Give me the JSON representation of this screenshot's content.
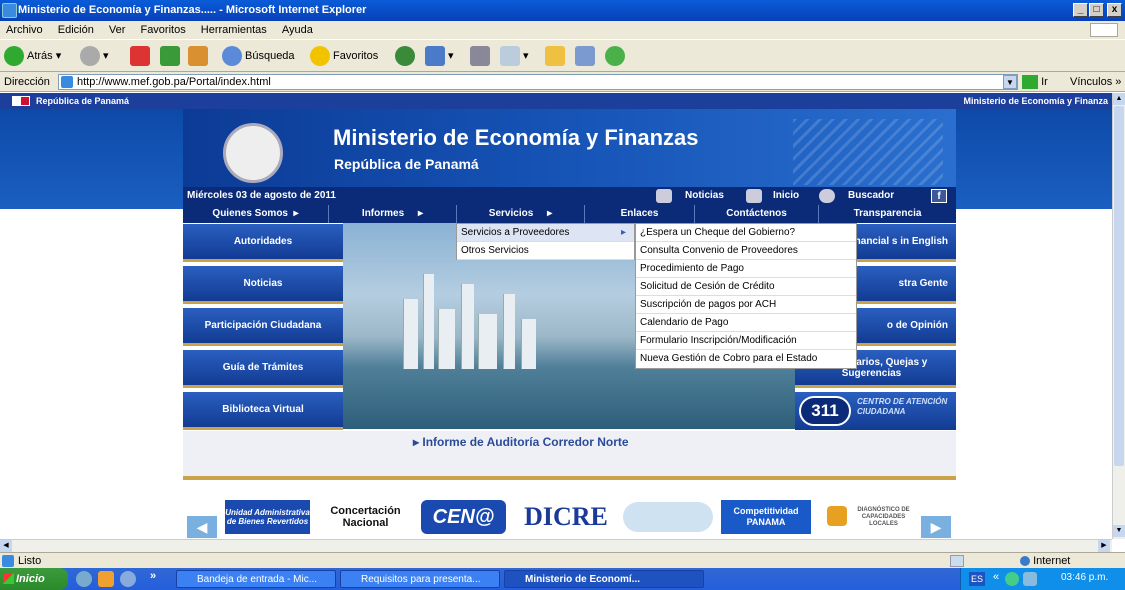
{
  "window": {
    "title": "Ministerio de Economía y Finanzas..... - Microsoft Internet Explorer",
    "min": "_",
    "max": "□",
    "close": "x"
  },
  "menubar": [
    "Archivo",
    "Edición",
    "Ver",
    "Favoritos",
    "Herramientas",
    "Ayuda"
  ],
  "toolbar": {
    "back": "Atrás",
    "search": "Búsqueda",
    "favorites": "Favoritos"
  },
  "address": {
    "label": "Dirección",
    "url": "http://www.mef.gob.pa/Portal/index.html",
    "go": "Ir",
    "links": "Vínculos"
  },
  "page": {
    "top_left": "República de Panamá",
    "top_right": "Ministerio de Economía y Finanza",
    "banner_title": "Ministerio de Economía y Finanzas",
    "banner_subtitle": "República de Panamá",
    "date": "Miércoles 03 de agosto de 2011",
    "quick_links": [
      "Noticias",
      "Inicio",
      "Buscador"
    ],
    "nav": [
      "Quienes Somos",
      "Informes",
      "Servicios",
      "Enlaces",
      "Contáctenos",
      "Transparencia"
    ],
    "left_buttons": [
      "Autoridades",
      "Noticias",
      "Participación Ciudadana",
      "Guía de Trámites",
      "Biblioteca Virtual"
    ],
    "right_buttons": [
      "c and Financial s in English",
      "stra Gente",
      "o de Opinión",
      "uzón de arios, Quejas y Sugerencias"
    ],
    "badge_311": "311",
    "badge_311_text": "CENTRO DE ATENCIÓN CIUDADANA",
    "servicios_menu": [
      "Servicios a Proveedores",
      "Otros Servicios"
    ],
    "proveedores_menu": [
      "¿Espera un Cheque del Gobierno?",
      "Consulta Convenio de Proveedores",
      "Procedimiento de Pago",
      "Solicitud de Cesión de Crédito",
      "Suscripción de pagos por ACH",
      "Calendario de Pago",
      "Formulario Inscripción/Modificación",
      "Nueva Gestión de Cobro para el Estado"
    ],
    "news_link": "Informe de Auditoría Corredor Norte",
    "logos": {
      "unidad": "Unidad Administrativa de Bienes Revertidos",
      "concertacion": "Concertación Nacional",
      "cena": "CEN@",
      "dicre": "DICRE",
      "competitividad": "Competitividad PANAMA",
      "diagnostico": "DIAGNÓSTICO DE CAPACIDADES LOCALES"
    }
  },
  "status": {
    "text": "Listo",
    "zone": "Internet"
  },
  "taskbar": {
    "start": "Inicio",
    "more": "»",
    "tasks": [
      "Bandeja de entrada - Mic...",
      "Requisitos para presenta...",
      "Ministerio de Economí..."
    ],
    "lang": "ES",
    "tray_more": "«",
    "clock": "03:46 p.m."
  }
}
